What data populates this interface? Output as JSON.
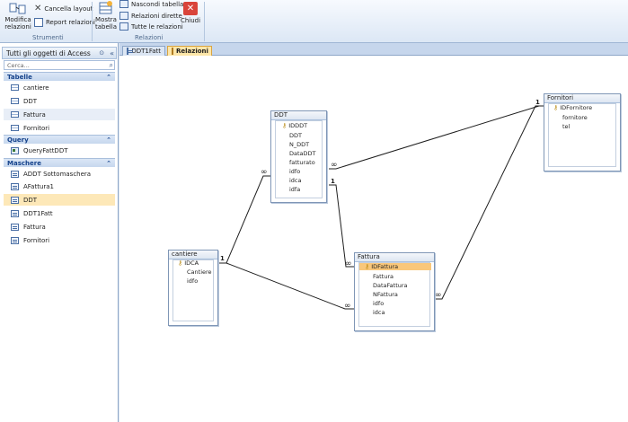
{
  "ribbon": {
    "groups": [
      {
        "label": "Strumenti"
      },
      {
        "label": "Relazioni"
      }
    ],
    "buttons": {
      "modifica": "Modifica relazioni",
      "cancella": "Cancella layout",
      "report": "Report relazioni",
      "mostra": "Mostra tabella",
      "nascondi": "Nascondi tabella",
      "dirette": "Relazioni dirette",
      "tutte": "Tutte le relazioni",
      "chiudi": "Chiudi"
    }
  },
  "nav": {
    "header": "Tutti gli oggetti di Access",
    "search_placeholder": "Cerca...",
    "sections": [
      {
        "title": "Tabelle",
        "items": [
          "cantiere",
          "DDT",
          "Fattura",
          "Fornitori"
        ]
      },
      {
        "title": "Query",
        "items": [
          "QueryFattDDT"
        ]
      },
      {
        "title": "Maschere",
        "items": [
          "ADDT Sottomaschera",
          "AFattura1",
          "DDT",
          "DDT1Fatt",
          "Fattura",
          "Fornitori"
        ]
      }
    ]
  },
  "tabs": [
    {
      "label": "DDT1Fatt"
    },
    {
      "label": "Relazioni"
    }
  ],
  "tables": {
    "ddt": {
      "title": "DDT",
      "fields": [
        "IDDDT",
        "DDT",
        "N_DDT",
        "DataDDT",
        "fatturato",
        "idfo",
        "idca",
        "idfa"
      ]
    },
    "fornitori": {
      "title": "Fornitori",
      "fields": [
        "IDFornitore",
        "fornitore",
        "tel"
      ]
    },
    "cantiere": {
      "title": "cantiere",
      "fields": [
        "IDCA",
        "Cantiere",
        "idfo"
      ]
    },
    "fattura": {
      "title": "Fattura",
      "fields": [
        "IDFattura",
        "Fattura",
        "DataFattura",
        "NFattura",
        "idfo",
        "idca"
      ]
    }
  },
  "rel": {
    "one": "1",
    "many": "∞"
  }
}
